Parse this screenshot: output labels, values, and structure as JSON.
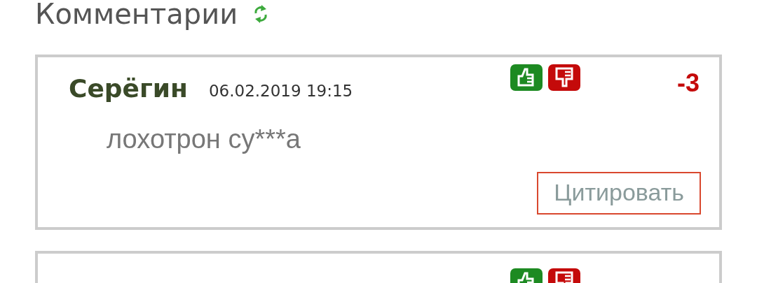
{
  "heading": {
    "title": "Комментарии"
  },
  "comments": [
    {
      "author": "Серёгин",
      "date": "06.02.2019 19:15",
      "score": "-3",
      "text": "лохотрон су***а",
      "quote_button": "Цитировать"
    },
    {
      "kind": "partial"
    }
  ]
}
